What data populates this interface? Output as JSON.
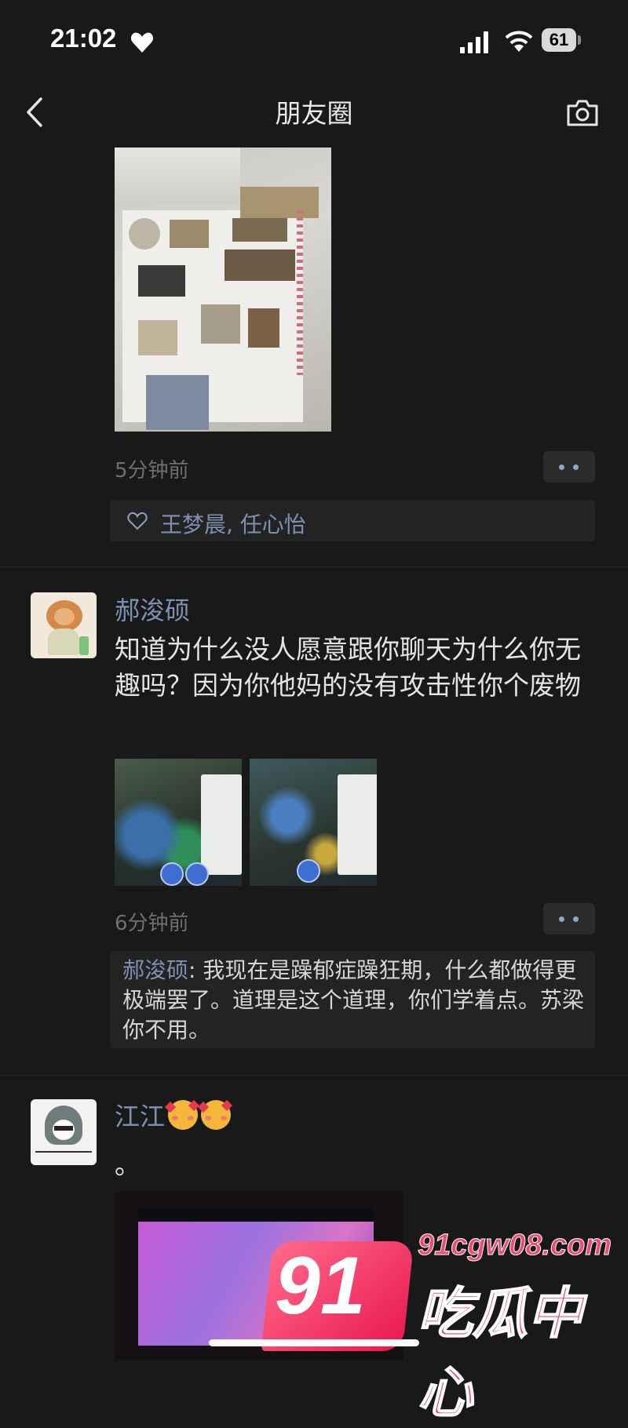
{
  "status_bar": {
    "time": "21:02",
    "battery": "61"
  },
  "nav": {
    "title": "朋友圈"
  },
  "post1": {
    "time": "5分钟前",
    "likes": "王梦晨, 任心怡"
  },
  "post2": {
    "author": "郝浚硕",
    "text": "知道为什么没人愿意跟你聊天为什么你无趣吗？因为你他妈的没有攻击性你个废物",
    "time": "6分钟前",
    "comment": {
      "author": "郝浚硕",
      "separator": ": ",
      "text": "我现在是躁郁症躁狂期，什么都做得更极端罢了。道理是这个道理，你们学着点。苏梁你不用。"
    }
  },
  "post3": {
    "author": "江江",
    "text": "。"
  },
  "watermark": {
    "number": "91",
    "url": "91cgw08.com",
    "name": "吃瓜中心"
  },
  "colors": {
    "background": "#191919",
    "link_blue": "#7f91b2",
    "panel": "#232323",
    "watermark_pink": "#f03a62"
  },
  "icons": [
    "heart-icon",
    "signal-icon",
    "wifi-icon",
    "battery-icon",
    "back-chevron-icon",
    "camera-icon",
    "more-dots-icon",
    "like-heart-icon"
  ]
}
